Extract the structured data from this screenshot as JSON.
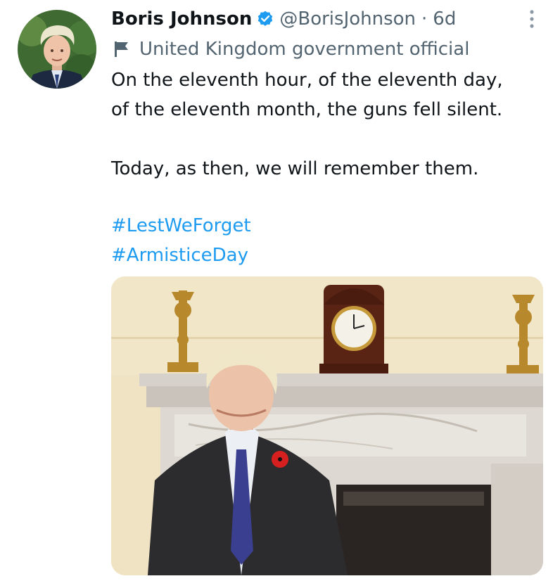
{
  "tweet": {
    "author": {
      "display_name": "Boris Johnson",
      "verified": true,
      "handle": "@BorisJohnson",
      "separator": "·",
      "time_ago": "6d",
      "label": "United Kingdom government official",
      "label_icon": "flag-icon"
    },
    "text": {
      "line1": "On the eleventh hour, of the eleventh day,",
      "line2": "of the eleventh month, the guns fell silent.",
      "line3": "Today, as then, we will remember them."
    },
    "hashtags": [
      "#LestWeForget",
      "#ArmisticeDay"
    ],
    "media": {
      "type": "photo"
    }
  },
  "colors": {
    "primary_text": "#0f1419",
    "secondary_text": "#536471",
    "link": "#1d9bf0",
    "verified_badge": "#1d9bf0"
  },
  "icons": [
    "verified-badge-icon",
    "more-options-icon",
    "flag-icon"
  ]
}
